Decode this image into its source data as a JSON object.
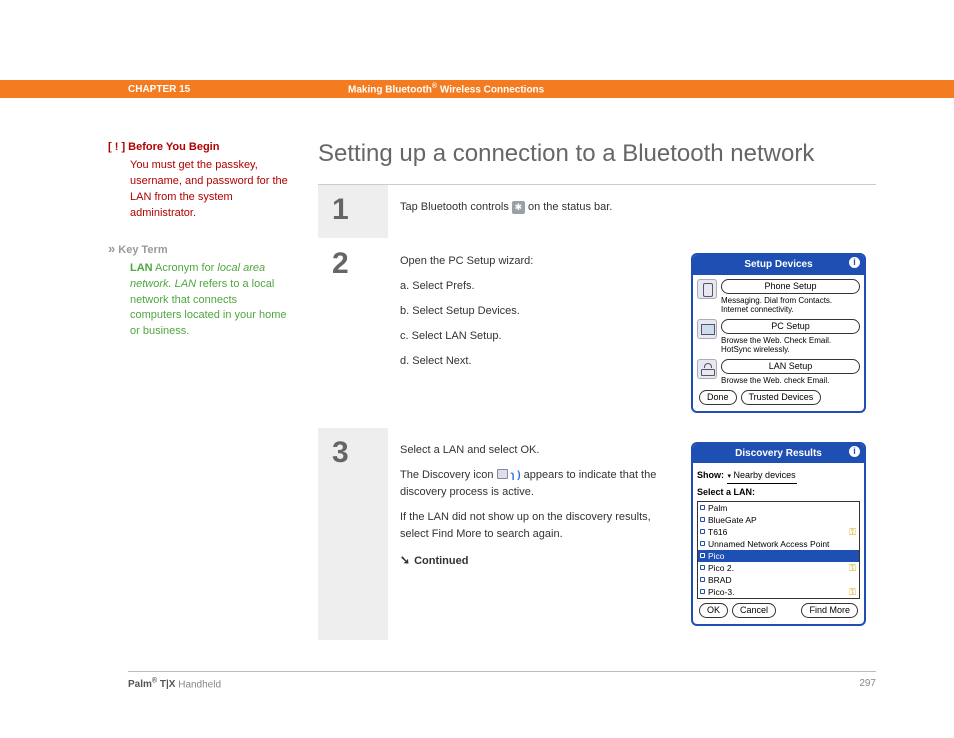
{
  "header": {
    "chapter": "CHAPTER 15",
    "title_before": "Making Bluetooth",
    "reg": "®",
    "title_after": " Wireless Connections"
  },
  "sidebar": {
    "before_begin": {
      "marker": "[ ! ]",
      "title": "Before You Begin",
      "body": "You must get the passkey, username, and password for the LAN from the system administrator."
    },
    "key_term": {
      "marker": "»",
      "title": "Key Term",
      "term": "LAN",
      "body_before": "   Acronym for ",
      "italic": "local area network. LAN",
      "body_after": " refers to a local network that connects computers located in your home or business."
    }
  },
  "page_title": "Setting up a connection to a Bluetooth network",
  "steps": {
    "s1": {
      "num": "1",
      "text_before": "Tap Bluetooth controls ",
      "text_after": " on the status bar."
    },
    "s2": {
      "num": "2",
      "intro": "Open the PC Setup wizard:",
      "a": "a.  Select Prefs.",
      "b": "b.  Select Setup Devices.",
      "c": "c.  Select LAN Setup.",
      "d": "d.  Select Next.",
      "device": {
        "title": "Setup Devices",
        "phone_btn": "Phone Setup",
        "phone_desc": "Messaging. Dial from Contacts. Internet connectivity.",
        "pc_btn": "PC Setup",
        "pc_desc": "Browse the Web. Check Email. HotSync wirelessly.",
        "lan_btn": "LAN Setup",
        "lan_desc": "Browse the Web. check Email.",
        "done": "Done",
        "trusted": "Trusted Devices"
      }
    },
    "s3": {
      "num": "3",
      "p1": "Select a LAN and select OK.",
      "p2a": "The Discovery icon ",
      "p2b": " appears to indicate that the discovery process is active.",
      "p3": "If the LAN did not show up on the discovery results, select Find More to search again.",
      "continued": "Continued",
      "device": {
        "title": "Discovery Results",
        "show_label": "Show:",
        "show_value": "Nearby devices",
        "select_label": "Select a LAN:",
        "items": {
          "i0": "Palm",
          "i1": "BlueGate AP",
          "i2": "T616",
          "i3": "Unnamed Network Access Point",
          "i4": "Pico",
          "i5": "Pico 2.",
          "i6": "BRAD",
          "i7": "Pico-3."
        },
        "ok": "OK",
        "cancel": "Cancel",
        "find_more": "Find More"
      }
    }
  },
  "footer": {
    "brand_before": "Palm",
    "reg": "®",
    "brand_after": " T|X",
    "suffix": " Handheld",
    "page_no": "297"
  }
}
